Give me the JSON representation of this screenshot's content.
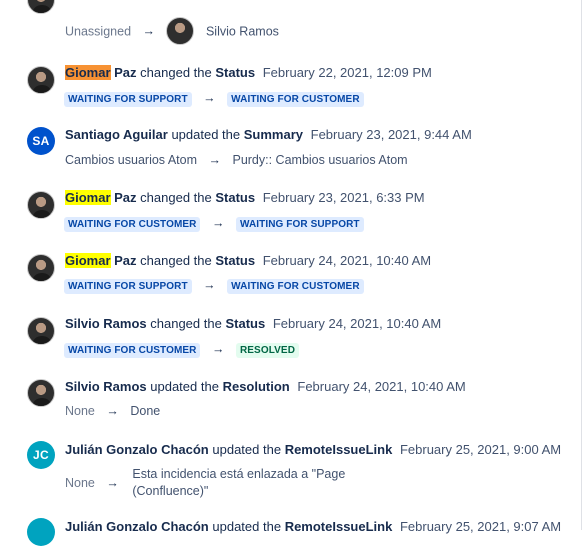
{
  "entries": [
    {
      "top_change": {
        "from": "Unassigned",
        "to_user": "Silvio Ramos"
      }
    },
    {
      "actor_first": "Giomar",
      "actor_rest": "Paz",
      "verb": "changed the",
      "field": "Status",
      "date": "February 22, 2021, 12:09 PM",
      "from": "WAITING FOR SUPPORT",
      "to": "WAITING FOR CUSTOMER"
    },
    {
      "actor": "Santiago Aguilar",
      "avatar_initials": "SA",
      "verb": "updated the",
      "field": "Summary",
      "date": "February 23, 2021, 9:44 AM",
      "from": "Cambios usuarios Atom",
      "to": "Purdy:: Cambios usuarios Atom"
    },
    {
      "actor_first": "Giomar",
      "actor_rest": "Paz",
      "verb": "changed the",
      "field": "Status",
      "date": "February 23, 2021, 6:33 PM",
      "from": "WAITING FOR CUSTOMER",
      "to": "WAITING FOR SUPPORT"
    },
    {
      "actor_first": "Giomar",
      "actor_rest": "Paz",
      "verb": "changed the",
      "field": "Status",
      "date": "February 24, 2021, 10:40 AM",
      "from": "WAITING FOR SUPPORT",
      "to": "WAITING FOR CUSTOMER"
    },
    {
      "actor": "Silvio Ramos",
      "verb": "changed the",
      "field": "Status",
      "date": "February 24, 2021, 10:40 AM",
      "from": "WAITING FOR CUSTOMER",
      "to": "RESOLVED"
    },
    {
      "actor": "Silvio Ramos",
      "verb": "updated the",
      "field": "Resolution",
      "date": "February 24, 2021, 10:40 AM",
      "from": "None",
      "to": "Done"
    },
    {
      "actor": "Julián Gonzalo Chacón",
      "avatar_initials": "JC",
      "verb": "updated the",
      "field": "RemoteIssueLink",
      "date": "February 25, 2021, 9:00 AM",
      "from": "None",
      "to": "Esta incidencia está enlazada a \"Page (Confluence)\""
    },
    {
      "actor": "Julián Gonzalo Chacón",
      "verb": "updated the",
      "field": "RemoteIssueLink",
      "date": "February 25, 2021, 9:07 AM"
    }
  ],
  "arrow_glyph": "→",
  "colors": {
    "highlight_orange": "#f79233",
    "highlight_yellow": "#ffff00",
    "lozenge_blue_bg": "#deebff",
    "lozenge_blue_text": "#0747a6",
    "lozenge_green_bg": "#e3fcef",
    "lozenge_green_text": "#006644",
    "avatar_sa": "#0052cc",
    "avatar_jc": "#00a3bf"
  }
}
